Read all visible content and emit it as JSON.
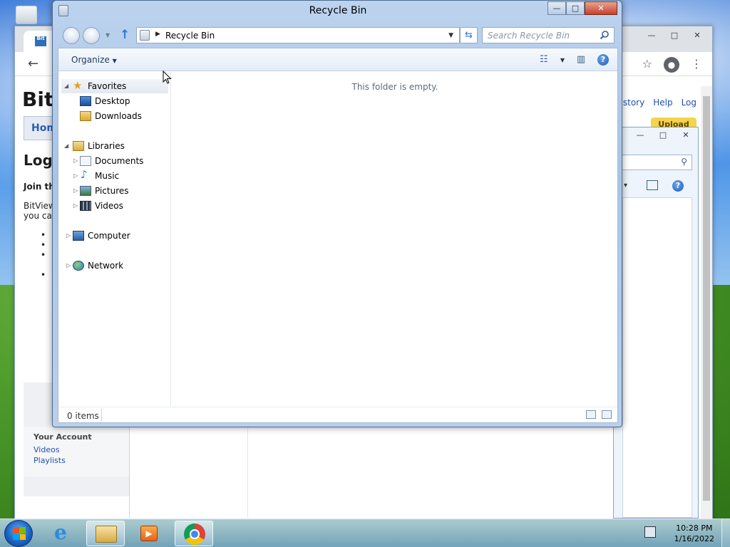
{
  "window": {
    "title": "Recycle Bin",
    "controls": {
      "minimize": "—",
      "maximize": "□",
      "close": "✕"
    }
  },
  "address_bar": {
    "location": "Recycle Bin",
    "search_placeholder": "Search Recycle Bin"
  },
  "command_bar": {
    "organize_label": "Organize",
    "help_label": "?"
  },
  "nav_pane": {
    "favorites": {
      "label": "Favorites",
      "items": [
        {
          "label": "Desktop"
        },
        {
          "label": "Downloads"
        }
      ]
    },
    "libraries": {
      "label": "Libraries",
      "items": [
        {
          "label": "Documents"
        },
        {
          "label": "Music"
        },
        {
          "label": "Pictures"
        },
        {
          "label": "Videos"
        }
      ]
    },
    "computer": {
      "label": "Computer"
    },
    "network": {
      "label": "Network"
    }
  },
  "content": {
    "empty_message": "This folder is empty."
  },
  "status_bar": {
    "items_count": "0 items"
  },
  "browser": {
    "tab_favicon_text": "Bit",
    "site_logo": "Bit",
    "home_tab": "Hom",
    "heading": "Logi",
    "join_text": "Join th",
    "desc_text": "BitView you can",
    "header_links": [
      "History",
      "Help",
      "Log"
    ],
    "upload_label": "Upload",
    "sidebar": {
      "title": "Your Account",
      "links": [
        "Videos",
        "Playlists"
      ]
    }
  },
  "taskbar": {
    "time": "10:28 PM",
    "date": "1/16/2022"
  },
  "colors": {
    "title_bar": "#bcd3ee",
    "link_blue": "#1f4fb0",
    "close_red": "#c5412a"
  },
  "icons": {
    "recycle_bin": "recycle-bin-icon",
    "search": "search-icon",
    "favorites": "star-icon",
    "libraries": "library-icon",
    "computer": "computer-icon",
    "network": "network-icon"
  }
}
